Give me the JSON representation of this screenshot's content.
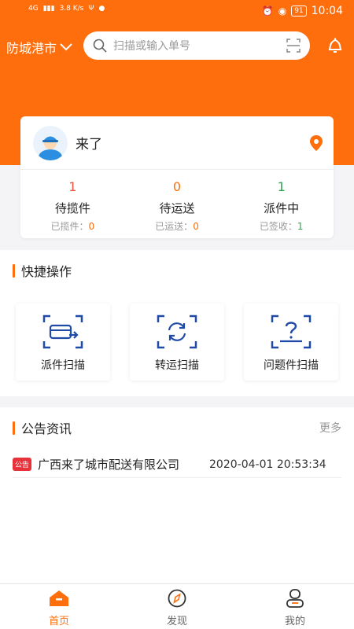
{
  "colors": {
    "accent": "#ff6e0d",
    "green": "#2ea44f",
    "badge": "#e8323b"
  },
  "statusbar": {
    "net": "4G",
    "speed": "3.8 K/s",
    "battery": "91",
    "time": "10:04"
  },
  "header": {
    "city": "防城港市",
    "search_placeholder": "扫描或输入单号"
  },
  "user": {
    "name": "来了"
  },
  "stats": [
    {
      "value": "1",
      "label": "待揽件",
      "sub_label": "已揽件：",
      "sub_value": "0"
    },
    {
      "value": "0",
      "label": "待运送",
      "sub_label": "已运送：",
      "sub_value": "0"
    },
    {
      "value": "1",
      "label": "派件中",
      "sub_label": "已签收：",
      "sub_value": "1"
    }
  ],
  "quick": {
    "title": "快捷操作",
    "items": [
      {
        "label": "派件扫描",
        "icon": "delivery-scan-icon"
      },
      {
        "label": "转运扫描",
        "icon": "transfer-scan-icon"
      },
      {
        "label": "问题件扫描",
        "icon": "problem-scan-icon"
      }
    ]
  },
  "notice": {
    "title": "公告资讯",
    "more": "更多",
    "items": [
      {
        "badge": "公告",
        "title": "广西来了城市配送有限公司",
        "time": "2020-04-01 20:53:34"
      }
    ]
  },
  "tabs": [
    {
      "label": "首页",
      "icon": "home-icon",
      "active": true
    },
    {
      "label": "发现",
      "icon": "compass-icon",
      "active": false
    },
    {
      "label": "我的",
      "icon": "profile-icon",
      "active": false
    }
  ]
}
